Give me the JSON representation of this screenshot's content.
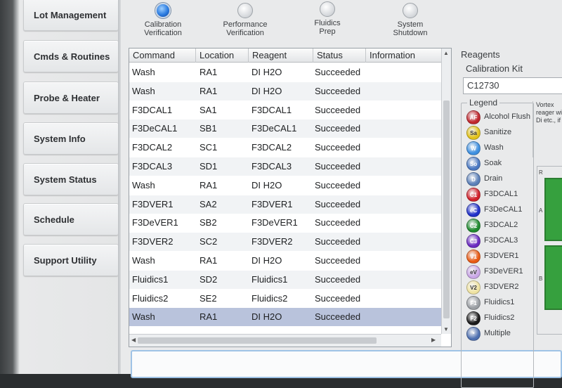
{
  "nav": {
    "items": [
      {
        "label": "Lot Management"
      },
      {
        "label": "Cmds & Routines"
      },
      {
        "label": "Probe & Heater"
      },
      {
        "label": "System Info"
      },
      {
        "label": "System Status"
      },
      {
        "label": "Schedule"
      },
      {
        "label": "Support Utility"
      }
    ]
  },
  "steps": [
    {
      "line1": "Calibration",
      "line2": "Verification",
      "active": true
    },
    {
      "line1": "Performance",
      "line2": "Verification",
      "active": false
    },
    {
      "line1": "Fluidics",
      "line2": "Prep",
      "active": false
    },
    {
      "line1": "System",
      "line2": "Shutdown",
      "active": false
    }
  ],
  "table": {
    "headers": [
      "Command",
      "Location",
      "Reagent",
      "Status",
      "Information"
    ],
    "rows": [
      {
        "command": "Wash",
        "location": "RA1",
        "reagent": "DI H2O",
        "status": "Succeeded"
      },
      {
        "command": "Wash",
        "location": "RA1",
        "reagent": "DI H2O",
        "status": "Succeeded"
      },
      {
        "command": "F3DCAL1",
        "location": "SA1",
        "reagent": "F3DCAL1",
        "status": "Succeeded"
      },
      {
        "command": "F3DeCAL1",
        "location": "SB1",
        "reagent": "F3DeCAL1",
        "status": "Succeeded"
      },
      {
        "command": "F3DCAL2",
        "location": "SC1",
        "reagent": "F3DCAL2",
        "status": "Succeeded"
      },
      {
        "command": "F3DCAL3",
        "location": "SD1",
        "reagent": "F3DCAL3",
        "status": "Succeeded"
      },
      {
        "command": "Wash",
        "location": "RA1",
        "reagent": "DI H2O",
        "status": "Succeeded"
      },
      {
        "command": "F3DVER1",
        "location": "SA2",
        "reagent": "F3DVER1",
        "status": "Succeeded"
      },
      {
        "command": "F3DeVER1",
        "location": "SB2",
        "reagent": "F3DeVER1",
        "status": "Succeeded"
      },
      {
        "command": "F3DVER2",
        "location": "SC2",
        "reagent": "F3DVER2",
        "status": "Succeeded"
      },
      {
        "command": "Wash",
        "location": "RA1",
        "reagent": "DI H2O",
        "status": "Succeeded"
      },
      {
        "command": "Fluidics1",
        "location": "SD2",
        "reagent": "Fluidics1",
        "status": "Succeeded"
      },
      {
        "command": "Fluidics2",
        "location": "SE2",
        "reagent": "Fluidics2",
        "status": "Succeeded"
      },
      {
        "command": "Wash",
        "location": "RA1",
        "reagent": "DI H2O",
        "status": "Succeeded"
      }
    ],
    "selected_row_index": 13
  },
  "reagents": {
    "title": "Reagents",
    "kit_label": "Calibration Kit",
    "kit_value": "C12730",
    "legend_title": "Legend",
    "legend": [
      {
        "code": "AF",
        "label": "Alcohol Flush",
        "color": "#c0262d"
      },
      {
        "code": "Sa",
        "label": "Sanitize",
        "color": "#e2c21a"
      },
      {
        "code": "W",
        "label": "Wash",
        "color": "#3d8fe0"
      },
      {
        "code": "So",
        "label": "Soak",
        "color": "#4a78c2"
      },
      {
        "code": "D",
        "label": "Drain",
        "color": "#5a7fb8"
      },
      {
        "code": "C1",
        "label": "F3DCAL1",
        "color": "#d0202a"
      },
      {
        "code": "eC",
        "label": "F3DeCAL1",
        "color": "#2030c8"
      },
      {
        "code": "C2",
        "label": "F3DCAL2",
        "color": "#1f8a2e"
      },
      {
        "code": "C3",
        "label": "F3DCAL3",
        "color": "#6a2ac0"
      },
      {
        "code": "V1",
        "label": "F3DVER1",
        "color": "#e85a14"
      },
      {
        "code": "eV",
        "label": "F3DeVER1",
        "color": "#c9a6e6"
      },
      {
        "code": "V2",
        "label": "F3DVER2",
        "color": "#efe3a2"
      },
      {
        "code": "F1",
        "label": "Fluidics1",
        "color": "#9a9ea3"
      },
      {
        "code": "F2",
        "label": "Fluidics2",
        "color": "#1a1a1a"
      },
      {
        "code": "*",
        "label": "Multiple",
        "color": "#4d6fb0"
      }
    ],
    "note": "Vortex reager with Di etc., if",
    "plate_rows": [
      "R",
      "A",
      "B"
    ]
  }
}
